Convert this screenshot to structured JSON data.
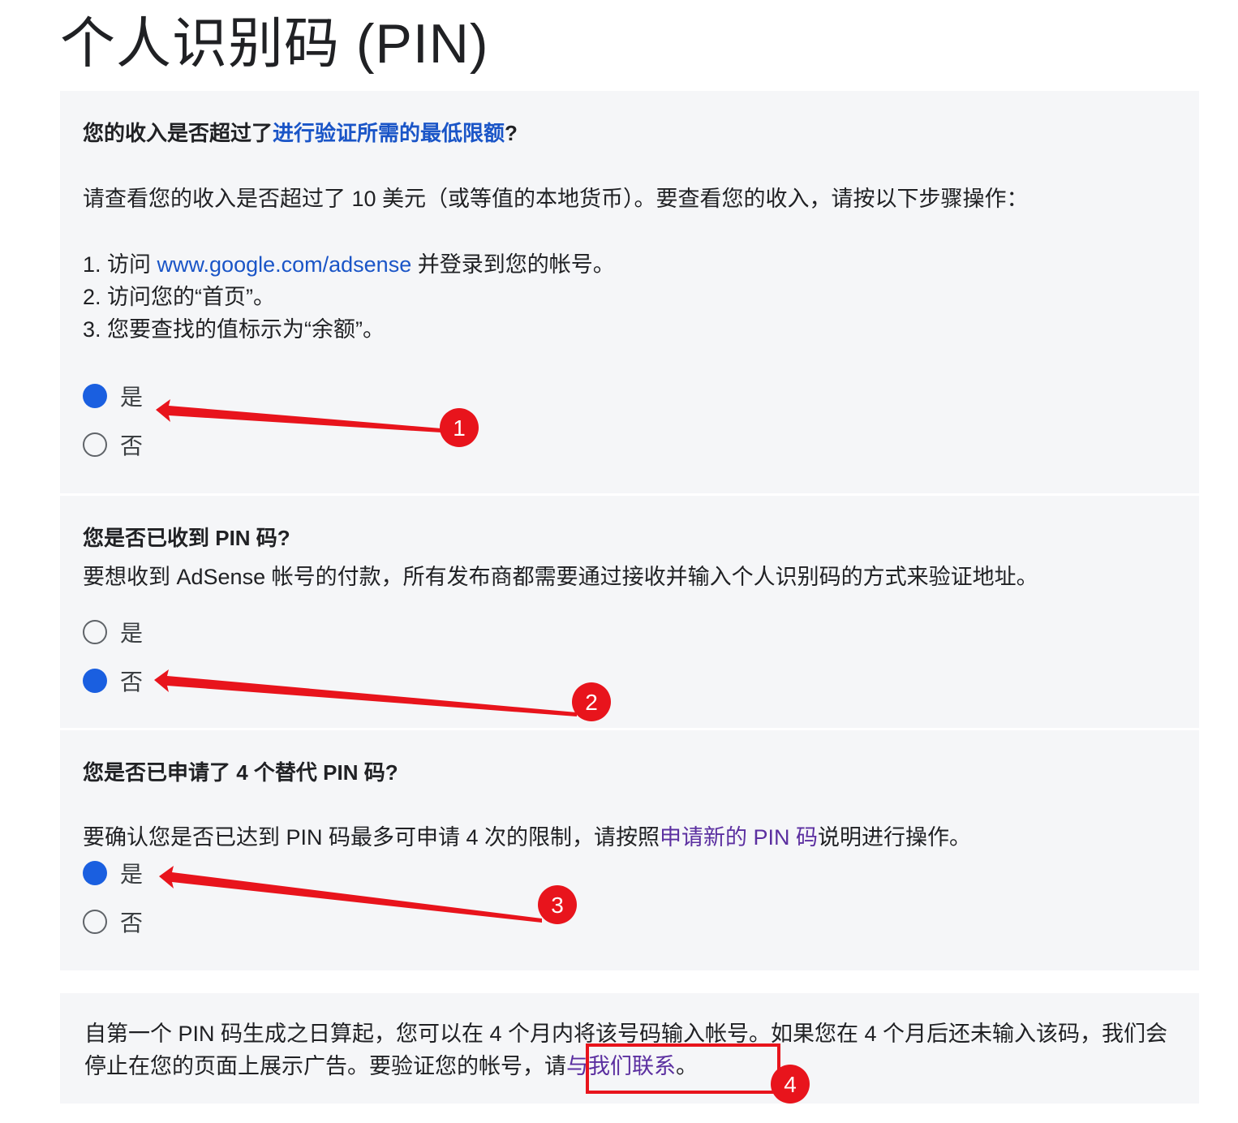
{
  "page": {
    "title": "个人识别码 (PIN)"
  },
  "q1": {
    "title_prefix": "您的收入是否超过了",
    "title_link": "进行验证所需的最低限额",
    "title_suffix": "?",
    "intro": "请查看您的收入是否超过了 10 美元（或等值的本地货币）。要查看您的收入，请按以下步骤操作：",
    "step1_prefix": "1. 访问 ",
    "step1_link": "www.google.com/adsense",
    "step1_suffix": " 并登录到您的帐号。",
    "step2": "2. 访问您的“首页”。",
    "step3": "3. 您要查找的值标示为“余额”。",
    "option_yes": "是",
    "option_no": "否",
    "selected": "是"
  },
  "q2": {
    "title": "您是否已收到 PIN 码?",
    "desc": "要想收到 AdSense 帐号的付款，所有发布商都需要通过接收并输入个人识别码的方式来验证地址。",
    "option_yes": "是",
    "option_no": "否",
    "selected": "否"
  },
  "q3": {
    "title": "您是否已申请了 4 个替代 PIN 码?",
    "desc_prefix": "要确认您是否已达到 PIN 码最多可申请 4 次的限制，请按照",
    "desc_link": "申请新的 PIN 码",
    "desc_suffix": "说明进行操作。",
    "option_yes": "是",
    "option_no": "否",
    "selected": "是"
  },
  "final": {
    "text_prefix": "自第一个 PIN 码生成之日算起，您可以在 4 个月内将该号码输入帐号。如果您在 4 个月后还未输入该码，我们会停止在您的页面上展示广告。要验证您的帐号，",
    "text_mid": "请",
    "link": "与我们联系",
    "text_suffix": "。"
  },
  "annotations": {
    "marker1": "1",
    "marker2": "2",
    "marker3": "3",
    "marker4": "4",
    "color": "#e8141c"
  },
  "colors": {
    "link": "#1a55c7",
    "visited_link": "#5b2fa0",
    "radio_selected": "#1a5fe0",
    "panel_bg": "#f5f6f8"
  }
}
